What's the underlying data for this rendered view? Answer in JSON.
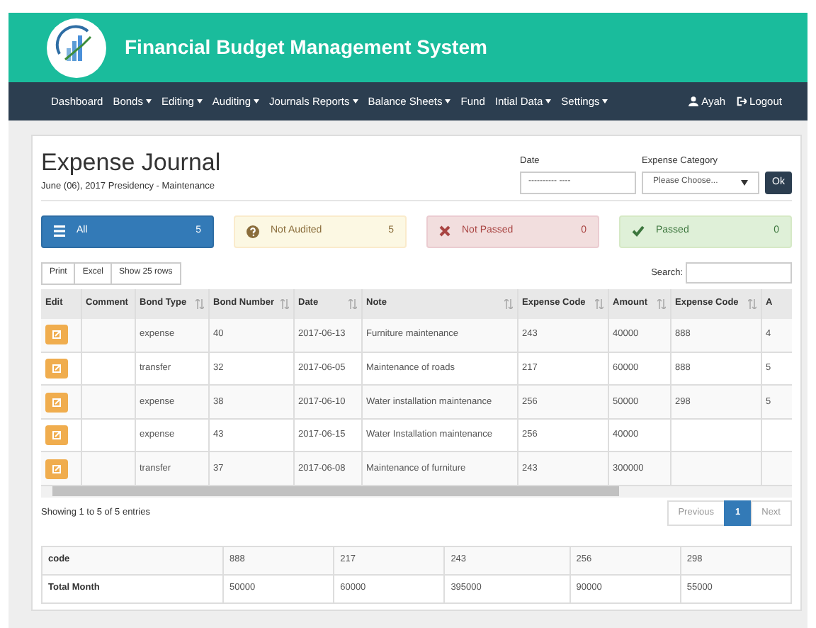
{
  "header": {
    "title": "Financial Budget Management System"
  },
  "nav": {
    "items": [
      {
        "label": "Dashboard",
        "dropdown": false
      },
      {
        "label": "Bonds",
        "dropdown": true
      },
      {
        "label": "Editing",
        "dropdown": true
      },
      {
        "label": "Auditing",
        "dropdown": true
      },
      {
        "label": "Journals Reports",
        "dropdown": true
      },
      {
        "label": "Balance Sheets",
        "dropdown": true
      },
      {
        "label": "Fund",
        "dropdown": false
      },
      {
        "label": "Intial Data",
        "dropdown": true
      },
      {
        "label": "Settings",
        "dropdown": true
      }
    ],
    "user": "Ayah",
    "logout": "Logout"
  },
  "page": {
    "title": "Expense Journal",
    "subtitle": "June (06), 2017 Presidency - Maintenance"
  },
  "filters": {
    "date_label": "Date",
    "date_value": "---------- ----",
    "category_label": "Expense Category",
    "category_value": "Please Choose...",
    "ok": "Ok"
  },
  "status_tabs": [
    {
      "kind": "all",
      "label": "All",
      "count": "5",
      "selected": true
    },
    {
      "kind": "not_audited",
      "label": "Not Audited",
      "count": "5",
      "selected": false
    },
    {
      "kind": "not_passed",
      "label": "Not Passed",
      "count": "0",
      "selected": false
    },
    {
      "kind": "passed",
      "label": "Passed",
      "count": "0",
      "selected": false
    }
  ],
  "table_buttons": [
    "Print",
    "Excel",
    "Show 25 rows"
  ],
  "search_label": "Search:",
  "table": {
    "columns": [
      {
        "label": "Edit",
        "sort": false
      },
      {
        "label": "Comment",
        "sort": false
      },
      {
        "label": "Bond Type",
        "sort": true
      },
      {
        "label": "Bond Number",
        "sort": true
      },
      {
        "label": "Date",
        "sort": true
      },
      {
        "label": "Note",
        "sort": true
      },
      {
        "label": "Expense Code",
        "sort": true
      },
      {
        "label": "Amount",
        "sort": true
      },
      {
        "label": "Expense Code",
        "sort": true
      },
      {
        "label": "A"
      }
    ],
    "rows": [
      [
        "",
        "",
        "expense",
        "40",
        "2017-06-13",
        "Furniture maintenance",
        "243",
        "40000",
        "888",
        "4"
      ],
      [
        "",
        "",
        "transfer",
        "32",
        "2017-06-05",
        "Maintenance of roads",
        "217",
        "60000",
        "888",
        "5"
      ],
      [
        "",
        "",
        "expense",
        "38",
        "2017-06-10",
        "Water installation maintenance",
        "256",
        "50000",
        "298",
        "5"
      ],
      [
        "",
        "",
        "expense",
        "43",
        "2017-06-15",
        "Water Installation maintenance",
        "256",
        "40000",
        "",
        ""
      ],
      [
        "",
        "",
        "transfer",
        "37",
        "2017-06-08",
        "Maintenance of furniture",
        "243",
        "300000",
        "",
        ""
      ]
    ]
  },
  "info": "Showing 1 to 5 of 5 entries",
  "pagination": [
    {
      "label": "Previous",
      "selected": false
    },
    {
      "label": "1",
      "selected": true
    },
    {
      "label": "Next",
      "selected": false
    }
  ],
  "summary": [
    [
      "code",
      "888",
      "217",
      "243",
      "256",
      "298"
    ],
    [
      "Total Month",
      "50000",
      "60000",
      "395000",
      "90000",
      "55000"
    ]
  ]
}
